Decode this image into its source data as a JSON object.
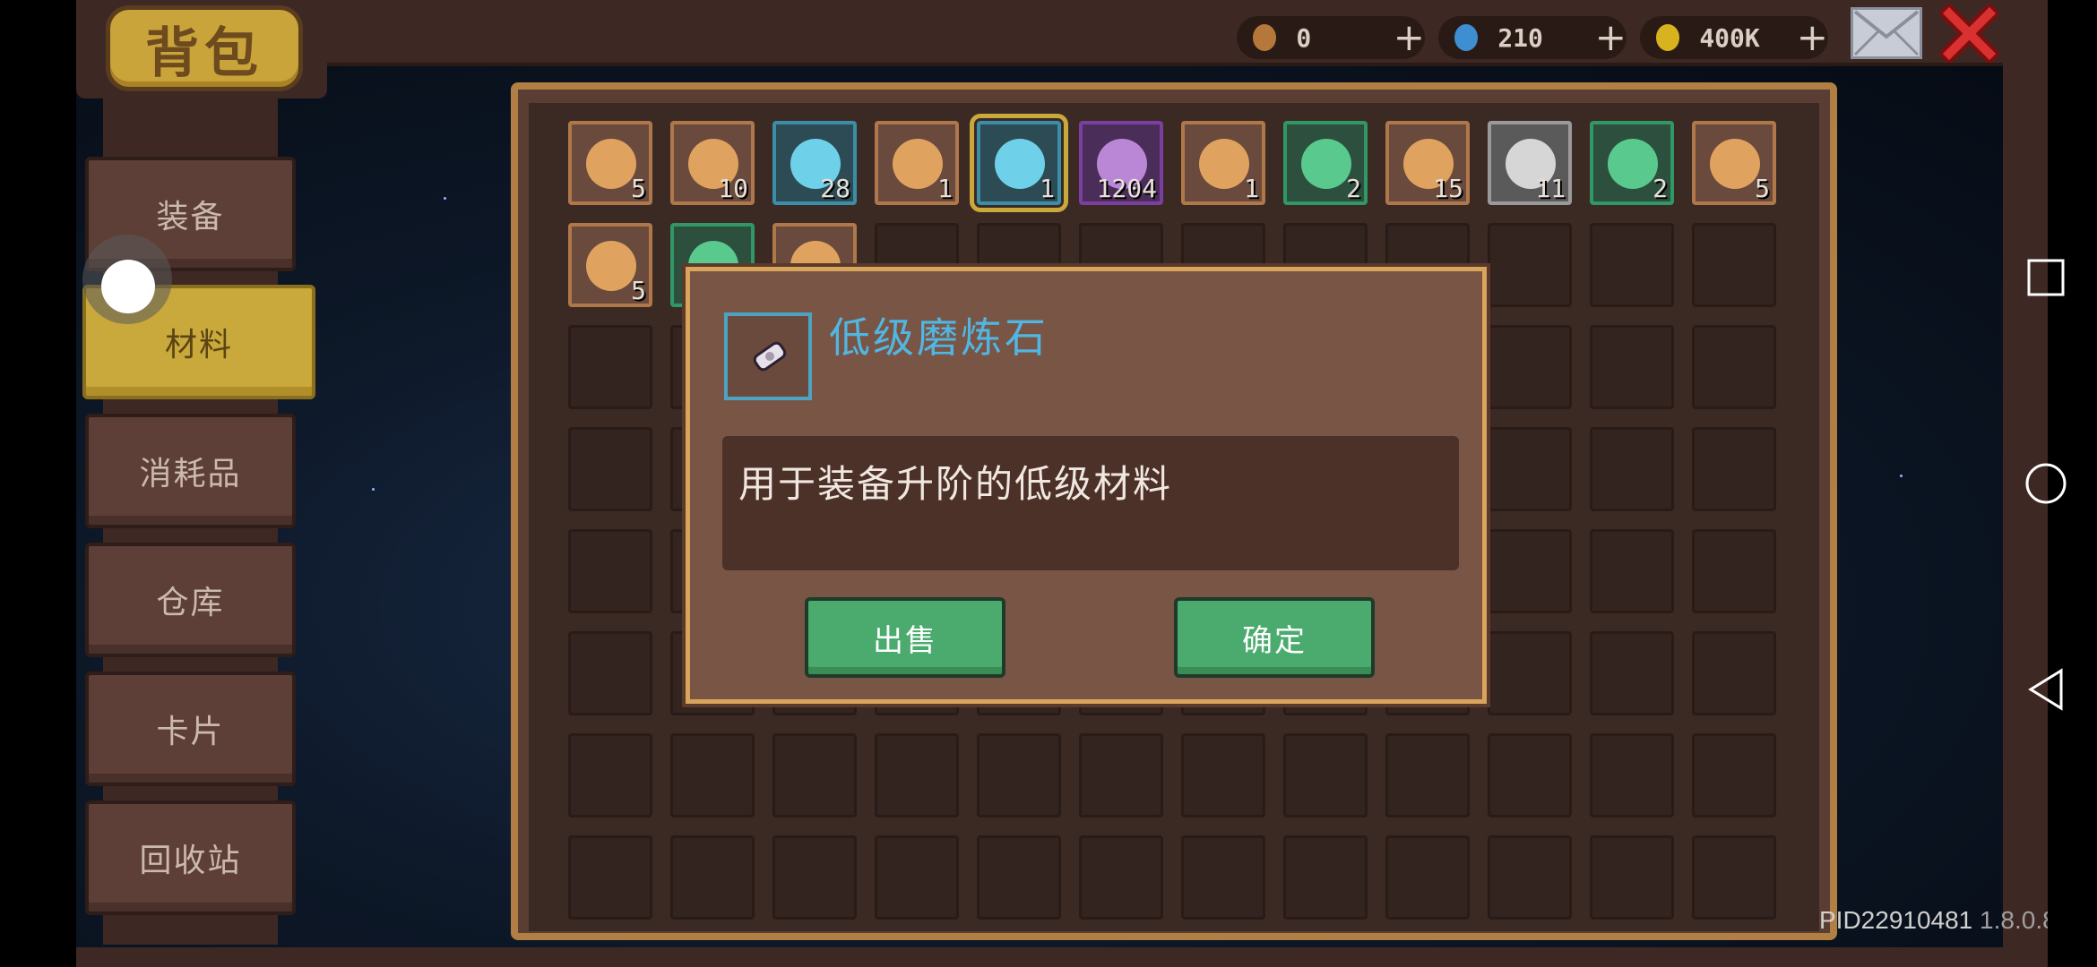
{
  "header": {
    "title": "背包",
    "currencies": [
      {
        "name": "seed",
        "value": "0",
        "plus": "+",
        "color": "#b5773a"
      },
      {
        "name": "gem",
        "value": "210",
        "plus": "+",
        "color": "#3d8fd1"
      },
      {
        "name": "gold",
        "value": "400K",
        "plus": "+",
        "color": "#d8b320"
      }
    ],
    "mail_icon": "mail-icon",
    "close_icon": "close-icon"
  },
  "sidebar": {
    "tabs": [
      {
        "label": "装备",
        "active": false
      },
      {
        "label": "材料",
        "active": true
      },
      {
        "label": "消耗品",
        "active": false
      },
      {
        "label": "仓库",
        "active": false
      },
      {
        "label": "卡片",
        "active": false
      },
      {
        "label": "回收站",
        "active": false
      }
    ]
  },
  "inventory": {
    "items": [
      {
        "count": "5",
        "icon": "key-icon",
        "rarity": "common"
      },
      {
        "count": "10",
        "icon": "scroll-icon",
        "rarity": "common"
      },
      {
        "count": "28",
        "icon": "coin-scroll-icon",
        "rarity": "blue"
      },
      {
        "count": "1",
        "icon": "orb-icon",
        "rarity": "common"
      },
      {
        "count": "1",
        "icon": "whetstone-icon",
        "rarity": "blue",
        "selected": true
      },
      {
        "count": "1204",
        "icon": "spiral-icon",
        "rarity": "purple"
      },
      {
        "count": "1",
        "icon": "vortex-icon",
        "rarity": "common"
      },
      {
        "count": "2",
        "icon": "dark-crystal-icon",
        "rarity": "green"
      },
      {
        "count": "15",
        "icon": "gem-cluster-icon",
        "rarity": "common"
      },
      {
        "count": "11",
        "icon": "silver-crown-icon",
        "rarity": "gray"
      },
      {
        "count": "2",
        "icon": "flame-crown-icon",
        "rarity": "green"
      },
      {
        "count": "5",
        "icon": "flower-stone-icon",
        "rarity": "common"
      },
      {
        "count": "5",
        "icon": "torch-icon",
        "rarity": "common"
      },
      {
        "count": "",
        "icon": "green-scroll-icon",
        "rarity": "green"
      },
      {
        "count": "",
        "icon": "hammer-icon",
        "rarity": "common"
      }
    ]
  },
  "dialog": {
    "title": "低级磨炼石",
    "description": "用于装备升阶的低级材料",
    "sell_label": "出售",
    "confirm_label": "确定",
    "icon": "whetstone-icon"
  },
  "footer": {
    "pid": "PID22910481",
    "version": "1.8.0.8"
  },
  "colors": {
    "accent_gold": "#c9a83c",
    "title_blue": "#51b6e2",
    "button_green": "#4bab6e",
    "panel_border": "#b17f44"
  }
}
